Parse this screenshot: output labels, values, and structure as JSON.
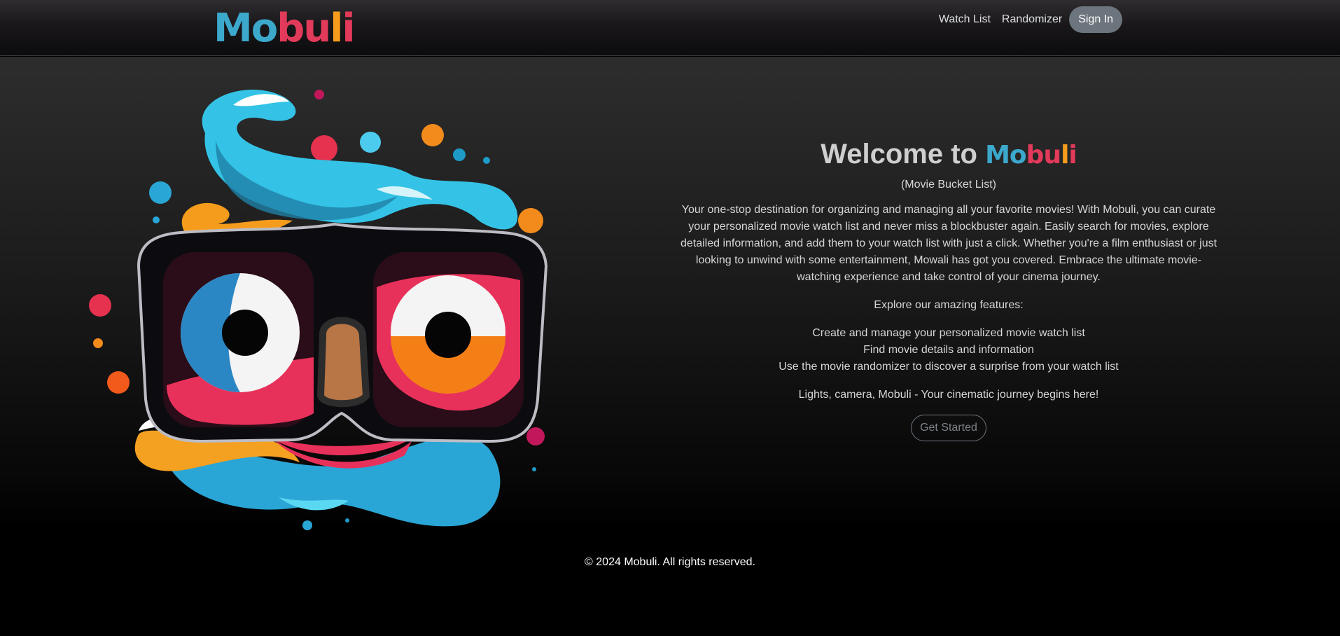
{
  "nav": {
    "logo": [
      "M",
      "o",
      "b",
      "u",
      "l",
      "i"
    ],
    "logo_colors": [
      "#3ca8cc",
      "#3ca8cc",
      "#e23a5a",
      "#e23a5a",
      "#f59c1d",
      "#e23a5a"
    ],
    "links": [
      "Watch List",
      "Randomizer"
    ],
    "signin_label": "Sign In"
  },
  "hero": {
    "mascot_icon": "mobuli-mascot-glasses-icon",
    "welcome_prefix": "Welcome to",
    "brand": "Mobuli",
    "subtitle": "(Movie Bucket List)",
    "description": "Your one-stop destination for organizing and managing all your favorite movies! With Mobuli, you can curate your personalized movie watch list and never miss a blockbuster again. Easily search for movies, explore detailed information, and add them to your watch list with just a click. Whether you're a film enthusiast or just looking to unwind with some entertainment, Mowali has got you covered. Embrace the ultimate movie-watching experience and take control of your cinema journey.",
    "features_intro": "Explore our amazing features:",
    "features": [
      "Create and manage your personalized movie watch list",
      "Find movie details and information",
      "Use the movie randomizer to discover a surprise from your watch list"
    ],
    "tagline": "Lights, camera, Mobuli - Your cinematic journey begins here!",
    "cta_label": "Get Started"
  },
  "footer": {
    "copyright": "© 2024 Mobuli. All rights reserved."
  },
  "colors": {
    "teal": "#3ca8cc",
    "red": "#e23a5a",
    "orange": "#f59c1d",
    "button_gray": "#6c757d"
  }
}
